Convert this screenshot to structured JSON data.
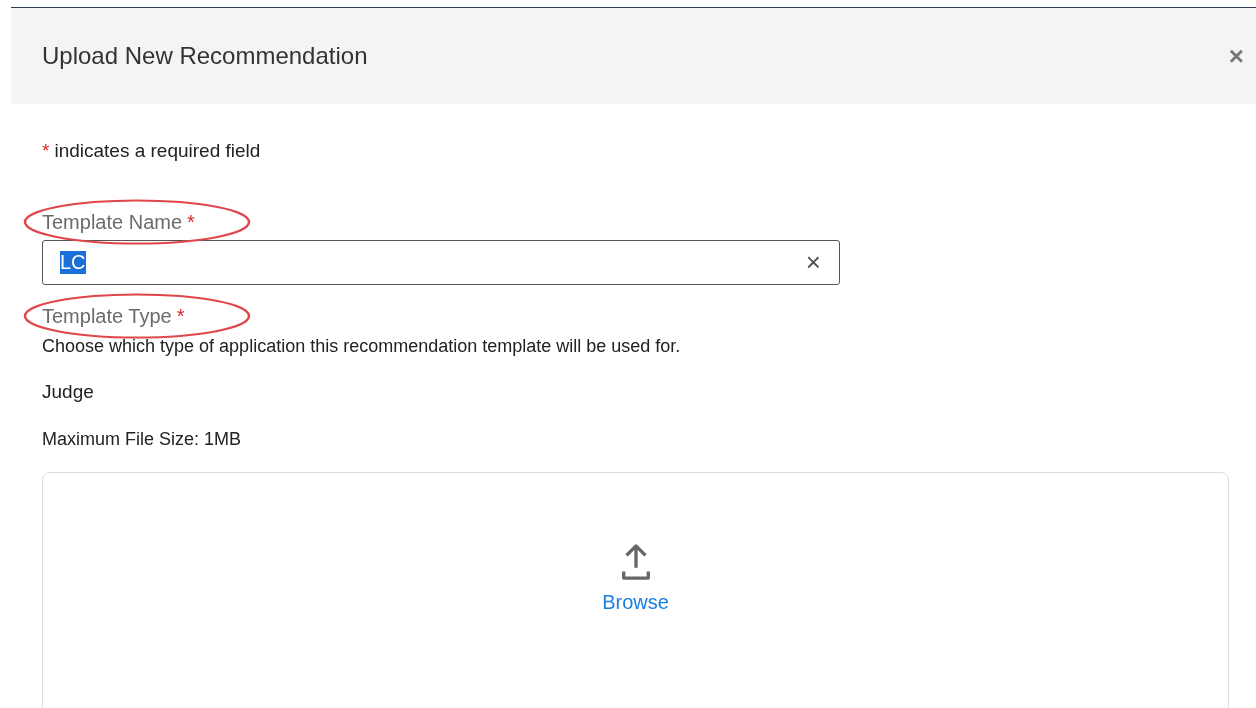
{
  "dialog": {
    "title": "Upload New Recommendation",
    "close": "×"
  },
  "required_note": {
    "mark": "*",
    "text": "indicates a required field"
  },
  "fields": [
    {
      "kind": "text",
      "label": "Template Name",
      "required_mark": "*",
      "highlighted": true,
      "value": "LC",
      "value_selected": true,
      "clear": "×"
    },
    {
      "kind": "static",
      "label": "Template Type",
      "required_mark": "*",
      "highlighted": true,
      "description": "Choose which type of application this recommendation template will be used for.",
      "value": "Judge"
    }
  ],
  "upload": {
    "limit": "Maximum File Size: 1MB",
    "action": "Browse"
  }
}
